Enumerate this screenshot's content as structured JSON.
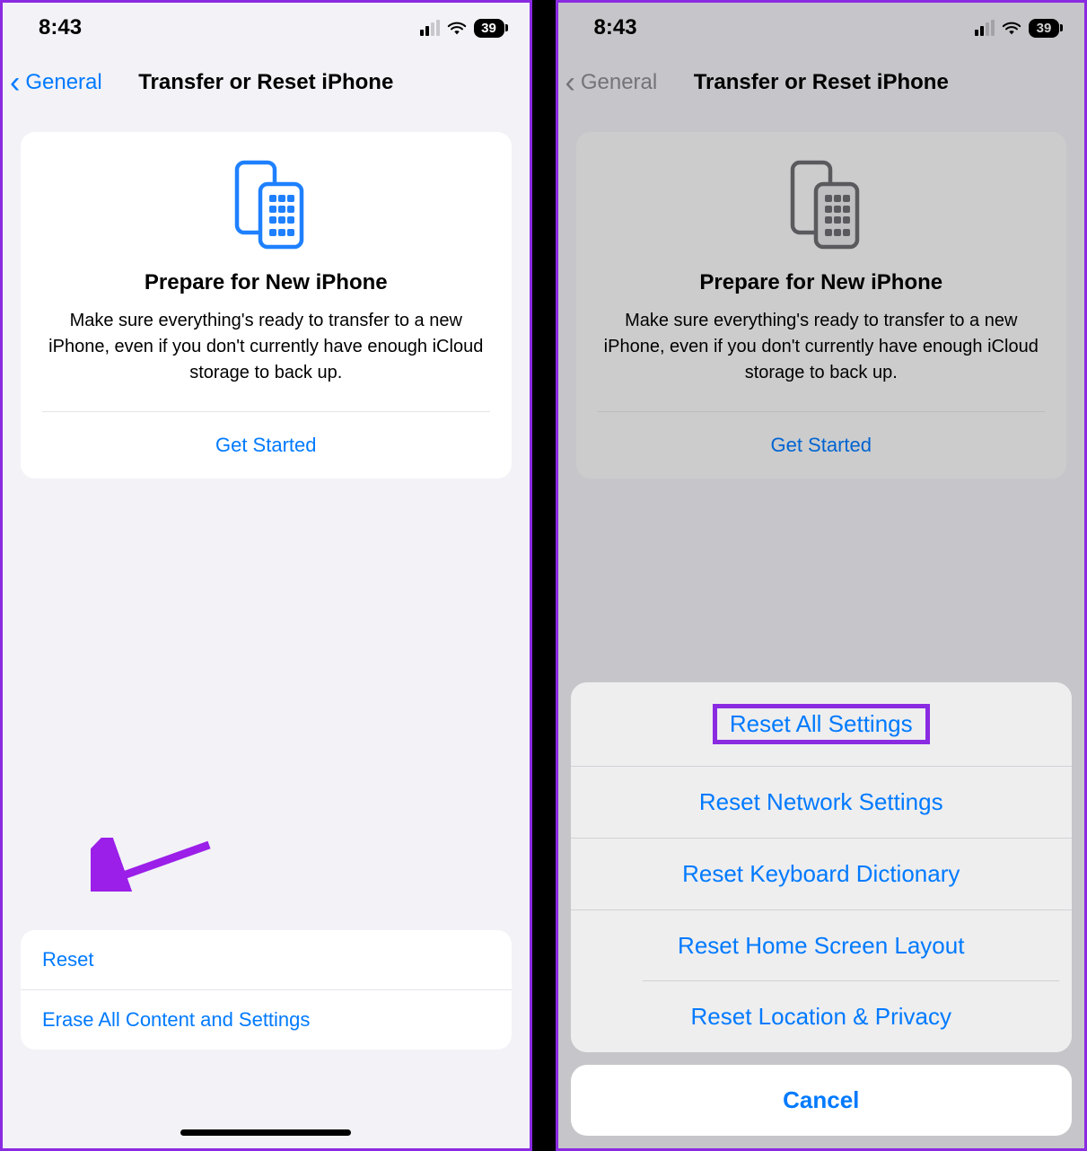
{
  "status": {
    "time": "8:43",
    "battery": "39"
  },
  "nav": {
    "back": "General",
    "title": "Transfer or Reset iPhone"
  },
  "card": {
    "title": "Prepare for New iPhone",
    "desc": "Make sure everything's ready to transfer to a new iPhone, even if you don't currently have enough iCloud storage to back up.",
    "cta": "Get Started"
  },
  "bottom": {
    "reset": "Reset",
    "erase": "Erase All Content and Settings"
  },
  "sheet": {
    "items": [
      "Reset All Settings",
      "Reset Network Settings",
      "Reset Keyboard Dictionary",
      "Reset Home Screen Layout",
      "Reset Location & Privacy"
    ],
    "cancel": "Cancel"
  }
}
